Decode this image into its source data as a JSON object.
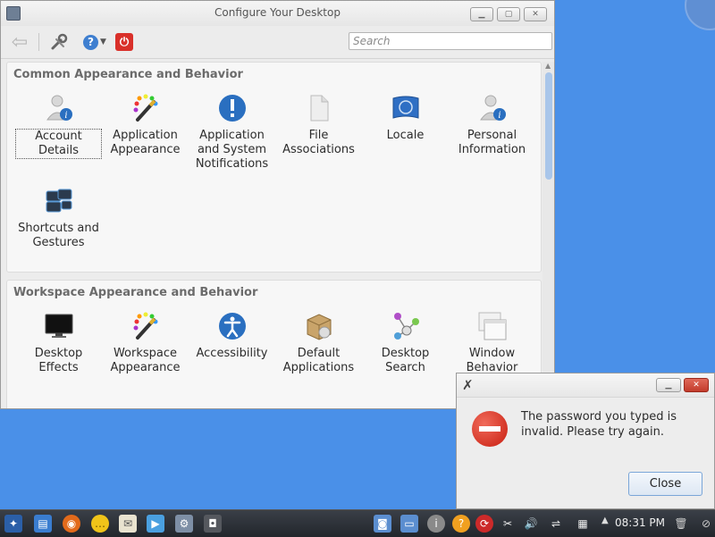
{
  "window": {
    "title": "Configure Your Desktop",
    "search_placeholder": "Search"
  },
  "sections": [
    {
      "title": "Common Appearance and Behavior",
      "items": [
        {
          "label": "Account Details",
          "icon": "account-details-icon"
        },
        {
          "label": "Application Appearance",
          "icon": "paintbrush-palette-icon"
        },
        {
          "label": "Application and System Notifications",
          "icon": "exclamation-icon"
        },
        {
          "label": "File Associations",
          "icon": "file-icon"
        },
        {
          "label": "Locale",
          "icon": "flag-icon"
        },
        {
          "label": "Personal Information",
          "icon": "personal-information-icon"
        },
        {
          "label": "Shortcuts and Gestures",
          "icon": "shortcuts-icon"
        }
      ]
    },
    {
      "title": "Workspace Appearance and Behavior",
      "items": [
        {
          "label": "Desktop Effects",
          "icon": "monitor-icon"
        },
        {
          "label": "Workspace Appearance",
          "icon": "paintbrush-palette-icon"
        },
        {
          "label": "Accessibility",
          "icon": "accessibility-icon"
        },
        {
          "label": "Default Applications",
          "icon": "package-icon"
        },
        {
          "label": "Desktop Search",
          "icon": "desktop-search-icon"
        },
        {
          "label": "Window Behavior",
          "icon": "window-behavior-icon"
        }
      ]
    }
  ],
  "dialog": {
    "message": "The password you typed is invalid. Please try again.",
    "close_label": "Close"
  },
  "taskbar": {
    "clock": "08:31 PM"
  },
  "colors": {
    "desktop": "#4a90e8",
    "accent_blue": "#3f7fd0",
    "error_red": "#d9302a"
  }
}
